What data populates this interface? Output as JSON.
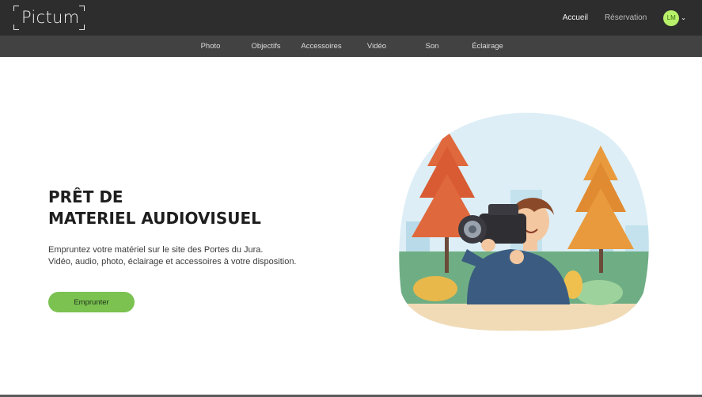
{
  "header": {
    "logo_text": "Pictum",
    "nav": {
      "accueil": "Accueil",
      "reservation": "Réservation"
    },
    "user": {
      "initials": "LM"
    }
  },
  "categories": [
    "Photo",
    "Objectifs",
    "Accessoires",
    "Vidéo",
    "Son",
    "Éclairage"
  ],
  "hero": {
    "title_line1": "PRÊT DE",
    "title_line2": "MATERIEL AUDIOVISUEL",
    "desc_line1": "Empruntez  votre matériel sur le site des Portes du Jura.",
    "desc_line2": "Vidéo, audio, photo, éclairage et accessoires à votre disposition.",
    "cta": "Emprunter"
  },
  "colors": {
    "topbar": "#2d2d2d",
    "catbar": "#424242",
    "accent": "#7bc251",
    "avatar": "#b8f06a"
  }
}
